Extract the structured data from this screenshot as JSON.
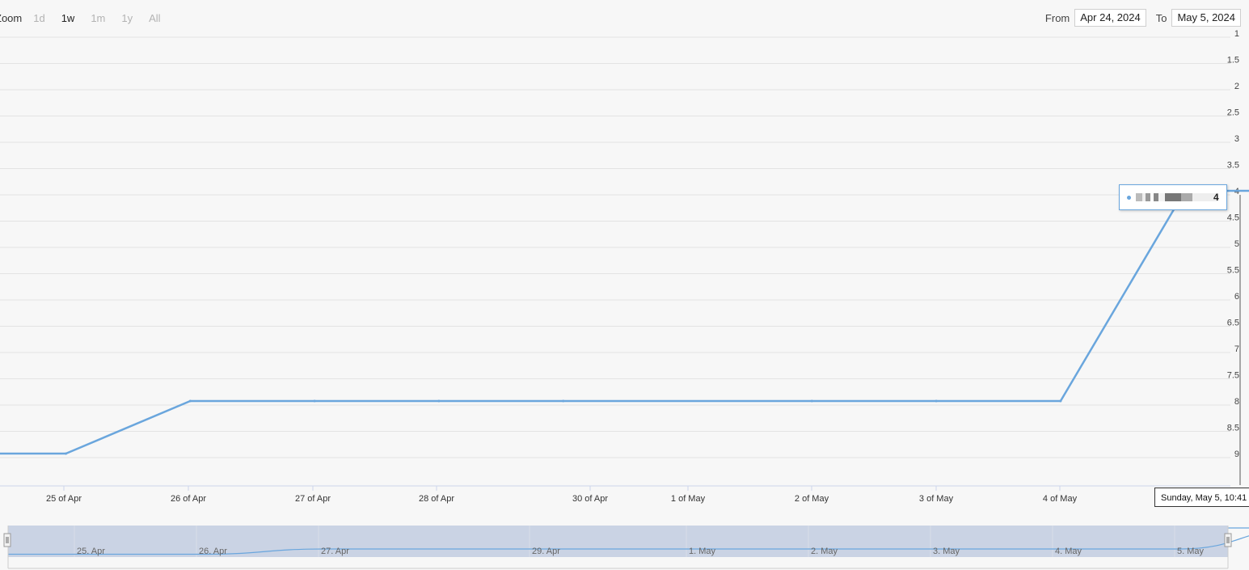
{
  "zoom": {
    "label": "Zoom",
    "buttons": [
      "1d",
      "1w",
      "1m",
      "1y",
      "All"
    ],
    "active": "1w"
  },
  "range": {
    "from_label": "From",
    "from_value": "Apr 24, 2024",
    "to_label": "To",
    "to_value": "May 5, 2024"
  },
  "tooltip": {
    "value": "4"
  },
  "crosshair_label": "Sunday, May 5, 10:41",
  "colors": {
    "series": "#6aa6dd",
    "navigator_mask": "#c2cce0",
    "grid": "#e3e3e3"
  },
  "chart_data": {
    "type": "line",
    "y_reversed": true,
    "ylim": [
      1,
      9
    ],
    "y_ticks": [
      "1",
      "1.5",
      "2",
      "2.5",
      "3",
      "3.5",
      "4",
      "4.5",
      "5",
      "5.5",
      "6",
      "6.5",
      "7",
      "7.5",
      "8",
      "8.5",
      "9"
    ],
    "x_ticks": [
      "25 of Apr",
      "26 of Apr",
      "27 of Apr",
      "28 of Apr",
      "30 of Apr",
      "1 of May",
      "2 of May",
      "3 of May",
      "4 of May"
    ],
    "x": [
      "Apr 24",
      "Apr 25",
      "Apr 26",
      "Apr 27",
      "Apr 28",
      "Apr 29",
      "May 1",
      "May 2",
      "May 3",
      "May 4",
      "May 5"
    ],
    "series": [
      {
        "values": [
          9,
          9,
          8,
          8,
          8,
          8,
          8,
          8,
          8,
          4,
          4
        ]
      }
    ],
    "navigator_ticks": [
      "25. Apr",
      "26. Apr",
      "27. Apr",
      "29. Apr",
      "1. May",
      "2. May",
      "3. May",
      "4. May",
      "5. May"
    ]
  }
}
